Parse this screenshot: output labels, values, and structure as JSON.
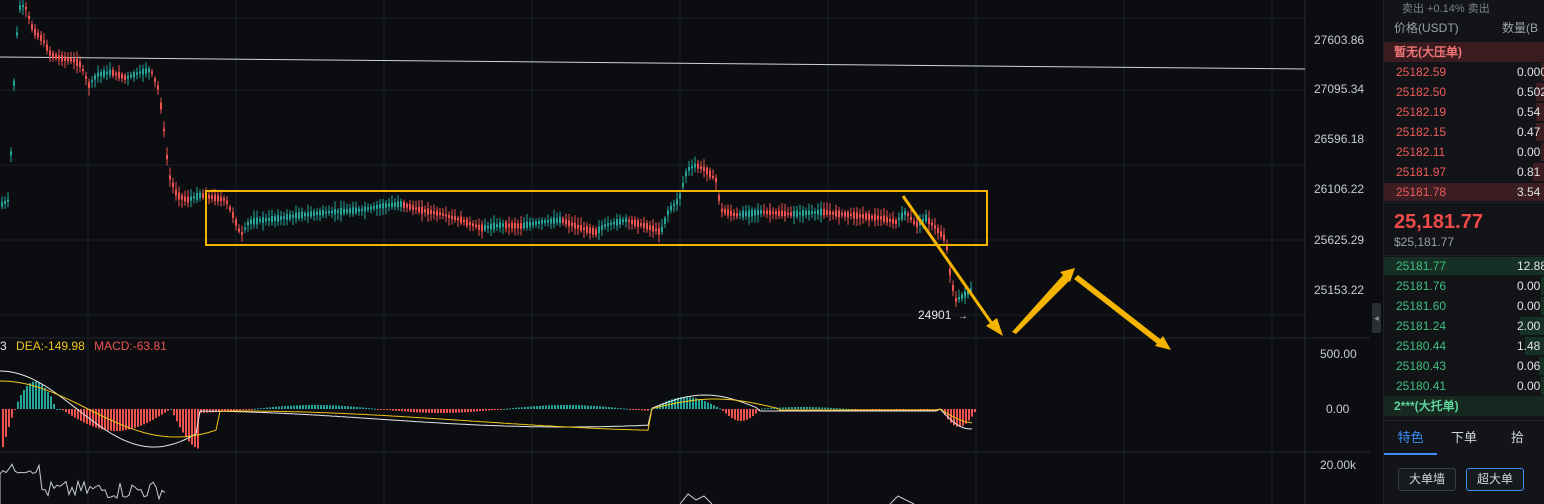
{
  "chart": {
    "y_ticks": [
      "27603.86",
      "27095.34",
      "26596.18",
      "26106.22",
      "25625.29",
      "25153.22"
    ],
    "macd_ticks": [
      "500.00",
      "0.00"
    ],
    "volume_tick": "20.00k",
    "macd_legend": {
      "partial": "3",
      "dea": "DEA:-149.98",
      "macd": "MACD:-63.81"
    },
    "low_label": "24901",
    "low_arrow": "→",
    "colors": {
      "up": "#26a69a",
      "down": "#ef5350",
      "annotation": "#f5b400",
      "dif_line": "#e8e8e8",
      "dea_line": "#f0c419",
      "macd_up": "#26a69a",
      "macd_down": "#ef5350"
    }
  },
  "orderbook": {
    "top_cut": "卖出   +0.14%     卖出",
    "price_header": "价格(USDT)",
    "qty_header": "数量(B",
    "ask_section": "暂无(大压单)",
    "asks": [
      {
        "price": "25182.59",
        "qty": "0.000",
        "depth": 0.02
      },
      {
        "price": "25182.50",
        "qty": "0.502",
        "depth": 0.05
      },
      {
        "price": "25182.19",
        "qty": "0.54",
        "depth": 0.05
      },
      {
        "price": "25182.15",
        "qty": "0.47",
        "depth": 0.05
      },
      {
        "price": "25182.11",
        "qty": "0.00",
        "depth": 0.02
      },
      {
        "price": "25181.97",
        "qty": "0.81",
        "depth": 0.07
      },
      {
        "price": "25181.78",
        "qty": "3.54",
        "depth": 1.0
      }
    ],
    "last_price": "25,181.77",
    "last_price_usd": "$25,181.77",
    "bids": [
      {
        "price": "25181.77",
        "qty": "12.88",
        "depth": 1.0
      },
      {
        "price": "25181.76",
        "qty": "0.00",
        "depth": 0.02
      },
      {
        "price": "25181.60",
        "qty": "0.00",
        "depth": 0.02
      },
      {
        "price": "25181.24",
        "qty": "2.00",
        "depth": 0.15
      },
      {
        "price": "25180.44",
        "qty": "1.48",
        "depth": 0.12
      },
      {
        "price": "25180.43",
        "qty": "0.06",
        "depth": 0.03
      },
      {
        "price": "25180.41",
        "qty": "0.00",
        "depth": 0.02
      }
    ],
    "bid_section": "2***(大托单)",
    "tabs": [
      "特色",
      "下单",
      "拾"
    ],
    "buttons": [
      "大单墙",
      "超大单"
    ],
    "collapse_glyph": "◂"
  }
}
